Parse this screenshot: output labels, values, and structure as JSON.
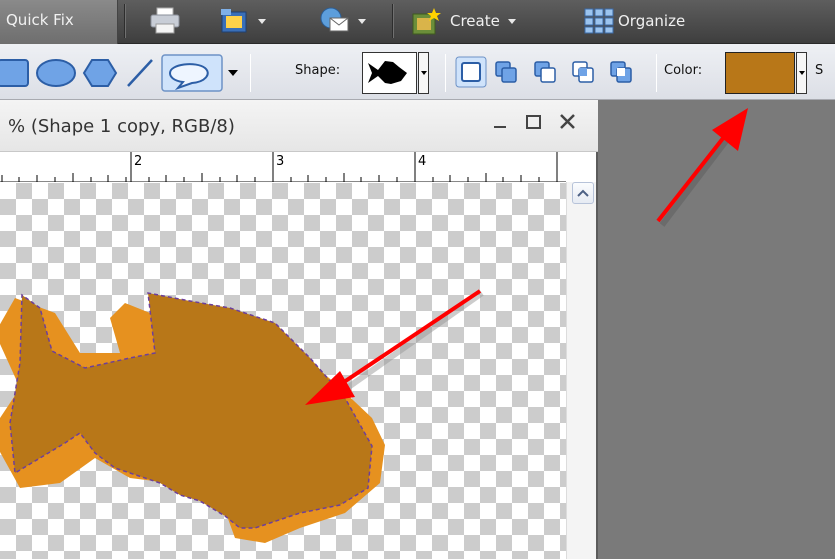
{
  "menubar": {
    "quick_fix": "Quick Fix",
    "create": "Create",
    "organize": "Organize"
  },
  "options": {
    "shape_label": "Shape:",
    "color_label": "Color:",
    "cut_label": "S",
    "selected_color": "#b87718"
  },
  "document": {
    "title": "% (Shape 1 copy, RGB/8)",
    "ruler_marks": [
      "2",
      "3",
      "4"
    ]
  },
  "colors": {
    "shape_fill": "#b87718",
    "shadow_shape": "#e6911f",
    "arrow": "#ff0000"
  },
  "icons": {
    "print": "printer-icon",
    "share": "share-icon",
    "mail": "mail-icon",
    "create": "create-icon",
    "organize": "grid-icon"
  }
}
